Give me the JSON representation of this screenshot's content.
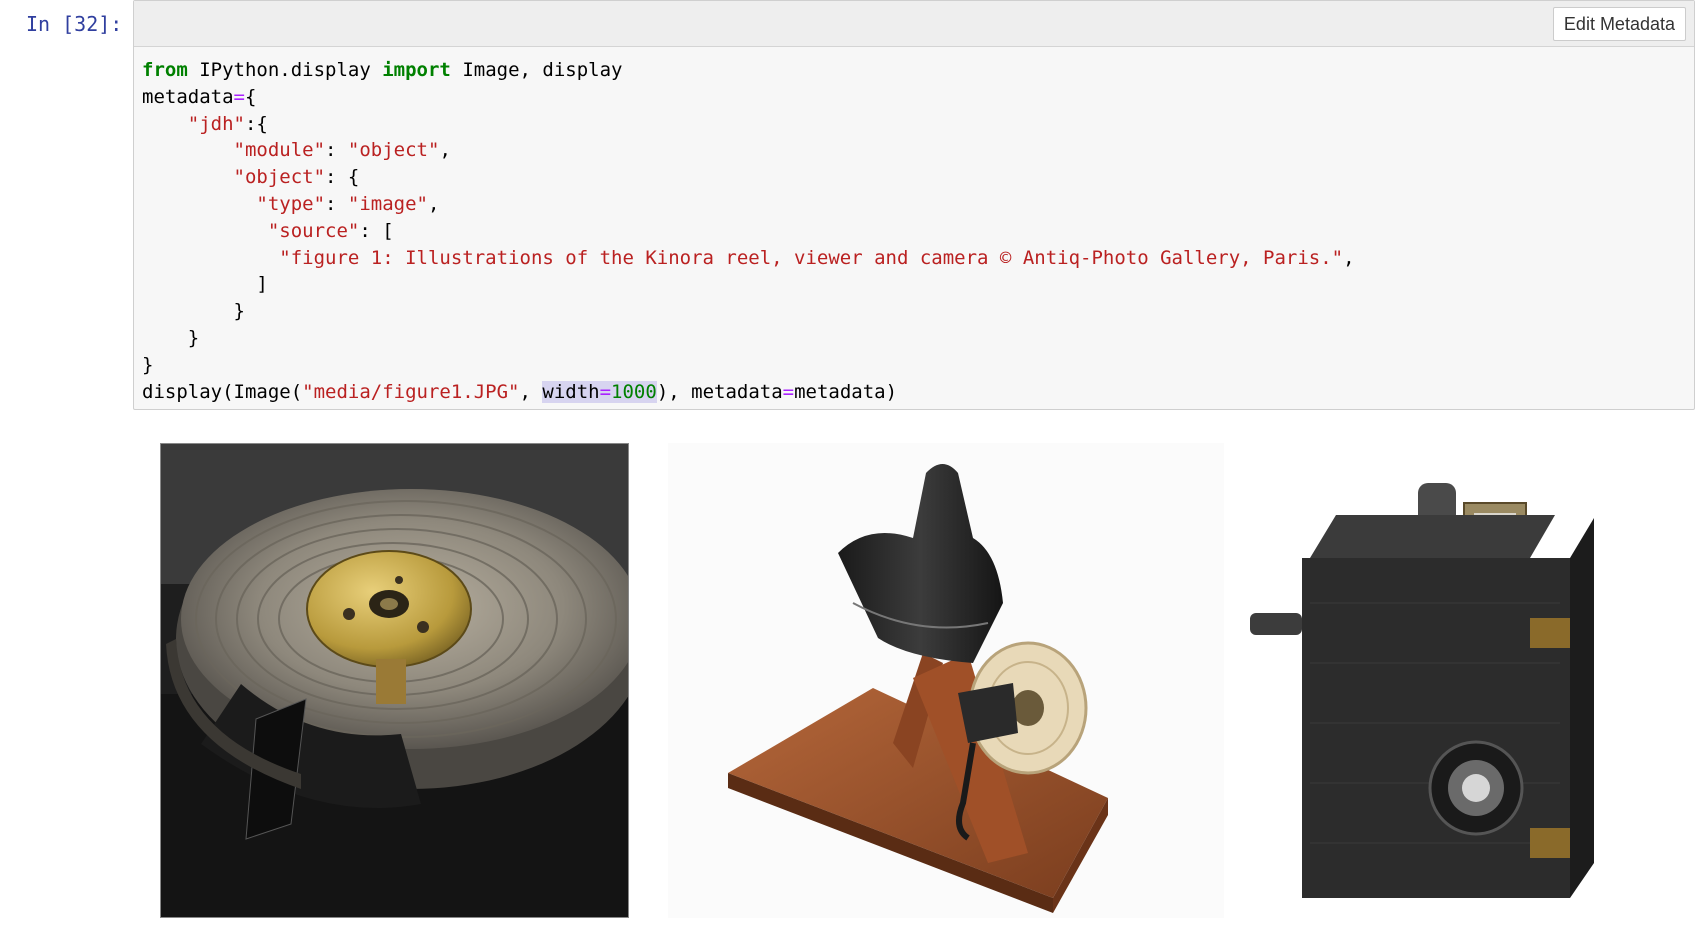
{
  "cell": {
    "prompt": "In [32]:",
    "toolbar": {
      "edit_metadata_label": "Edit Metadata"
    },
    "code": {
      "l1_kw1": "from",
      "l1_a": " IPython.display ",
      "l1_kw2": "import",
      "l1_b": " Image, display",
      "l2_a": "metadata",
      "l2_op": "=",
      "l2_b": "{",
      "l3_indent": "    ",
      "l3_str": "\"jdh\"",
      "l3_b": ":{",
      "l4_indent": "        ",
      "l4_str1": "\"module\"",
      "l4_b": ": ",
      "l4_str2": "\"object\"",
      "l4_c": ",",
      "l5_indent": "        ",
      "l5_str": "\"object\"",
      "l5_b": ": {",
      "l6_indent": "          ",
      "l6_str1": "\"type\"",
      "l6_b": ": ",
      "l6_str2": "\"image\"",
      "l6_c": ",",
      "l7_indent": "           ",
      "l7_str": "\"source\"",
      "l7_b": ": [",
      "l8_indent": "            ",
      "l8_str": "\"figure 1: Illustrations of the Kinora reel, viewer and camera © Antiq-Photo Gallery, Paris.\"",
      "l8_c": ",",
      "l9": "          ]",
      "l10": "        }",
      "l11": "    }",
      "l12": "}",
      "l13_a": "display(Image(",
      "l13_str": "\"media/figure1.JPG\"",
      "l13_b": ", ",
      "l13_hl_kw": "width",
      "l13_hl_op": "=",
      "l13_hl_num": "1000",
      "l13_c": "), metadata",
      "l13_op": "=",
      "l13_d": "metadata)"
    }
  },
  "output": {
    "images": [
      {
        "name": "Kinora reel"
      },
      {
        "name": "Kinora viewer"
      },
      {
        "name": "Kinora camera"
      }
    ]
  },
  "colors": {
    "prompt": "#303f9f",
    "keyword": "#008000",
    "string": "#ba2121",
    "operator": "#aa22ff",
    "number": "#008000",
    "highlight": "#d7d4f0"
  }
}
